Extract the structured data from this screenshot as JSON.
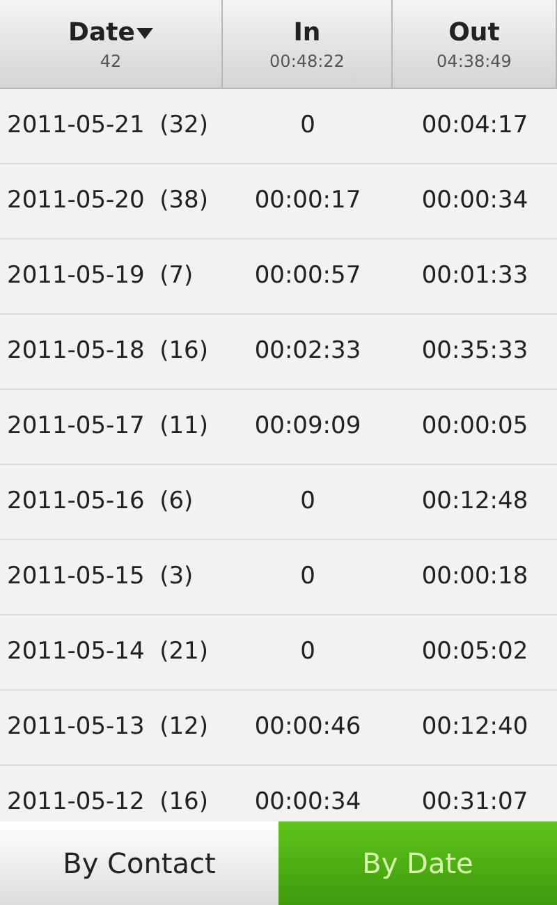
{
  "table": {
    "columns": [
      {
        "label": "Date",
        "total": "42",
        "sorted": true
      },
      {
        "label": "In",
        "total": "00:48:22",
        "sorted": false
      },
      {
        "label": "Out",
        "total": "04:38:49",
        "sorted": false
      }
    ],
    "rows": [
      {
        "date": "2011-05-21  (32)",
        "in": "0",
        "out": "00:04:17"
      },
      {
        "date": "2011-05-20  (38)",
        "in": "00:00:17",
        "out": "00:00:34"
      },
      {
        "date": "2011-05-19  (7)",
        "in": "00:00:57",
        "out": "00:01:33"
      },
      {
        "date": "2011-05-18  (16)",
        "in": "00:02:33",
        "out": "00:35:33"
      },
      {
        "date": "2011-05-17  (11)",
        "in": "00:09:09",
        "out": "00:00:05"
      },
      {
        "date": "2011-05-16  (6)",
        "in": "0",
        "out": "00:12:48"
      },
      {
        "date": "2011-05-15  (3)",
        "in": "0",
        "out": "00:00:18"
      },
      {
        "date": "2011-05-14  (21)",
        "in": "0",
        "out": "00:05:02"
      },
      {
        "date": "2011-05-13  (12)",
        "in": "00:00:46",
        "out": "00:12:40"
      },
      {
        "date": "2011-05-12  (16)",
        "in": "00:00:34",
        "out": "00:31:07"
      }
    ]
  },
  "tabs": [
    {
      "label": "By Contact",
      "selected": false
    },
    {
      "label": "By Date",
      "selected": true
    }
  ]
}
